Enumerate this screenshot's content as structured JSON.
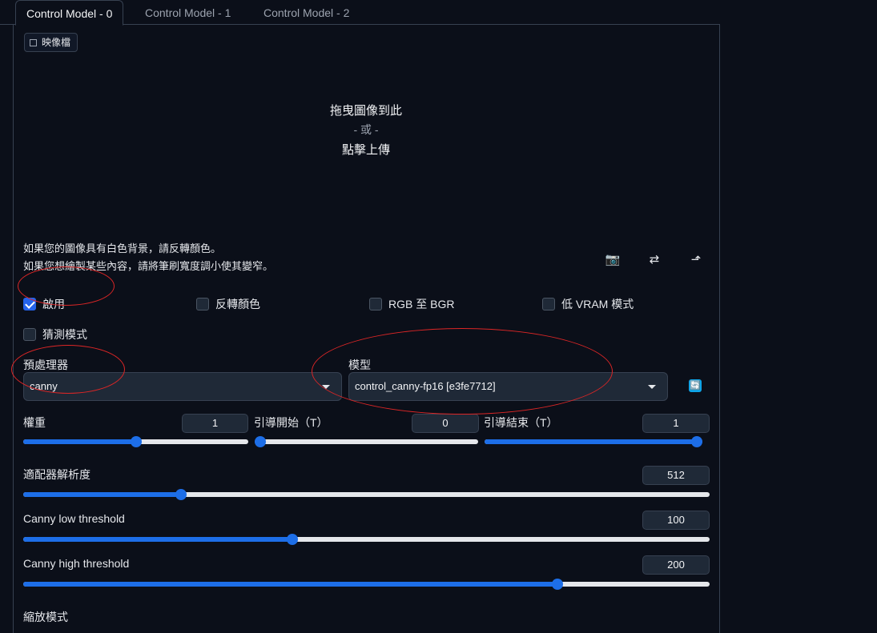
{
  "tabs": [
    {
      "label": "Control Model - 0",
      "active": true
    },
    {
      "label": "Control Model - 1",
      "active": false
    },
    {
      "label": "Control Model - 2",
      "active": false
    }
  ],
  "image_label": "映像檔",
  "drop": {
    "line1": "拖曳圖像到此",
    "line2": "- 或 -",
    "line3": "點擊上傳"
  },
  "hints": [
    "如果您的圖像具有白色背景，請反轉顏色。",
    "如果您想繪製某些內容，請將筆刷寬度調小使其變窄。"
  ],
  "tools": {
    "camera": "📷",
    "swap": "⇄",
    "send": "⬏"
  },
  "checkboxes": {
    "enable": {
      "label": "啟用",
      "checked": true
    },
    "invert": {
      "label": "反轉顏色",
      "checked": false
    },
    "rgb_bgr": {
      "label": "RGB 至 BGR",
      "checked": false
    },
    "low_vram": {
      "label": "低 VRAM 模式",
      "checked": false
    },
    "guess": {
      "label": "猜測模式",
      "checked": false
    }
  },
  "preprocessor": {
    "label": "預處理器",
    "value": "canny"
  },
  "model": {
    "label": "模型",
    "value": "control_canny-fp16 [e3fe7712]"
  },
  "refresh_icon": "🔄",
  "sliders": {
    "weight": {
      "label": "權重",
      "value": "1",
      "min": 0,
      "max": 2,
      "v": 1
    },
    "guidance_start": {
      "label": "引導開始（T）",
      "value": "0",
      "min": 0,
      "max": 1,
      "v": 0
    },
    "guidance_end": {
      "label": "引導結束（T）",
      "value": "1",
      "min": 0,
      "max": 1,
      "v": 1
    },
    "annotator_res": {
      "label": "適配器解析度",
      "value": "512",
      "min": 64,
      "max": 2048,
      "v": 512
    },
    "canny_low": {
      "label": "Canny low threshold",
      "value": "100",
      "min": 1,
      "max": 255,
      "v": 100
    },
    "canny_high": {
      "label": "Canny high threshold",
      "value": "200",
      "min": 1,
      "max": 255,
      "v": 200
    }
  },
  "resize_mode": {
    "label": "縮放模式"
  },
  "annotation_color": "#dc2626"
}
